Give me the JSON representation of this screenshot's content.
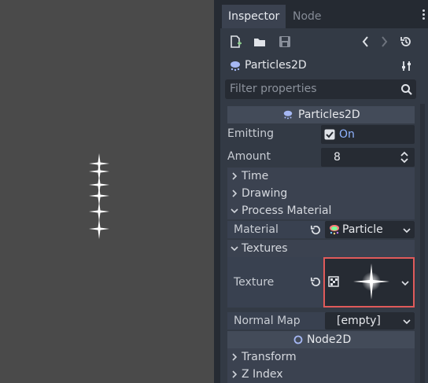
{
  "tabs": [
    {
      "label": "Inspector"
    },
    {
      "label": "Node"
    }
  ],
  "toolbar": {
    "icons": [
      "new-resource-icon",
      "open-folder-icon",
      "save-icon",
      "history-back-icon",
      "history-forward-icon",
      "object-history-icon"
    ]
  },
  "object": {
    "name": "Particles2D",
    "icon": "particles-icon",
    "settings_icon": "object-settings-icon"
  },
  "filter": {
    "placeholder": "Filter properties"
  },
  "section_particles": {
    "title": "Particles2D"
  },
  "props": {
    "emitting": {
      "label": "Emitting",
      "value": "On",
      "checked": true
    },
    "amount": {
      "label": "Amount",
      "value": "8"
    }
  },
  "groups": {
    "time": "Time",
    "drawing": "Drawing",
    "process_material": "Process Material",
    "textures": "Textures",
    "transform": "Transform",
    "z_index": "Z Index"
  },
  "material": {
    "label": "Material",
    "value": "Particle"
  },
  "texture": {
    "label": "Texture"
  },
  "normal_map": {
    "label": "Normal Map",
    "value": "[empty]"
  },
  "section_node2d": {
    "title": "Node2D"
  },
  "colors": {
    "viewport_bg": "#4a4a4a",
    "panel_bg": "#333a45",
    "accent": "#8fb3ff",
    "highlight": "#e05a5a"
  }
}
